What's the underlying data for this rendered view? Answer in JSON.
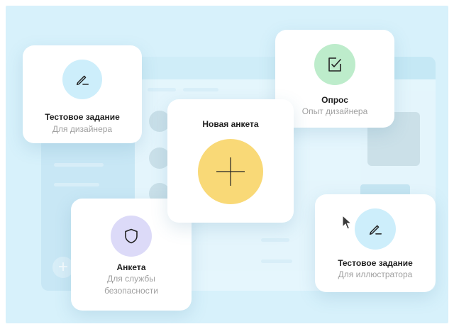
{
  "cards": {
    "test_designer": {
      "title": "Тестовое задание",
      "subtitle": "Для дизайнера",
      "icon": "pencil-icon"
    },
    "survey": {
      "title": "Опрос",
      "subtitle": "Опыт дизайнера",
      "icon": "checkbox-icon"
    },
    "new_form": {
      "title": "Новая анкета",
      "icon": "plus-icon"
    },
    "questionnaire": {
      "title": "Анкета",
      "subtitle_line1": "Для службы",
      "subtitle_line2": "безопасности",
      "icon": "shield-icon"
    },
    "test_illustrator": {
      "title": "Тестовое задание",
      "subtitle": "Для иллюстратора",
      "icon": "pencil-icon"
    }
  },
  "colors": {
    "background": "#d7f1fb",
    "pencil_circle": "#cdeefb",
    "check_circle": "#bdeccb",
    "plus_circle": "#f9d977",
    "shield_circle": "#dcdaf8"
  }
}
